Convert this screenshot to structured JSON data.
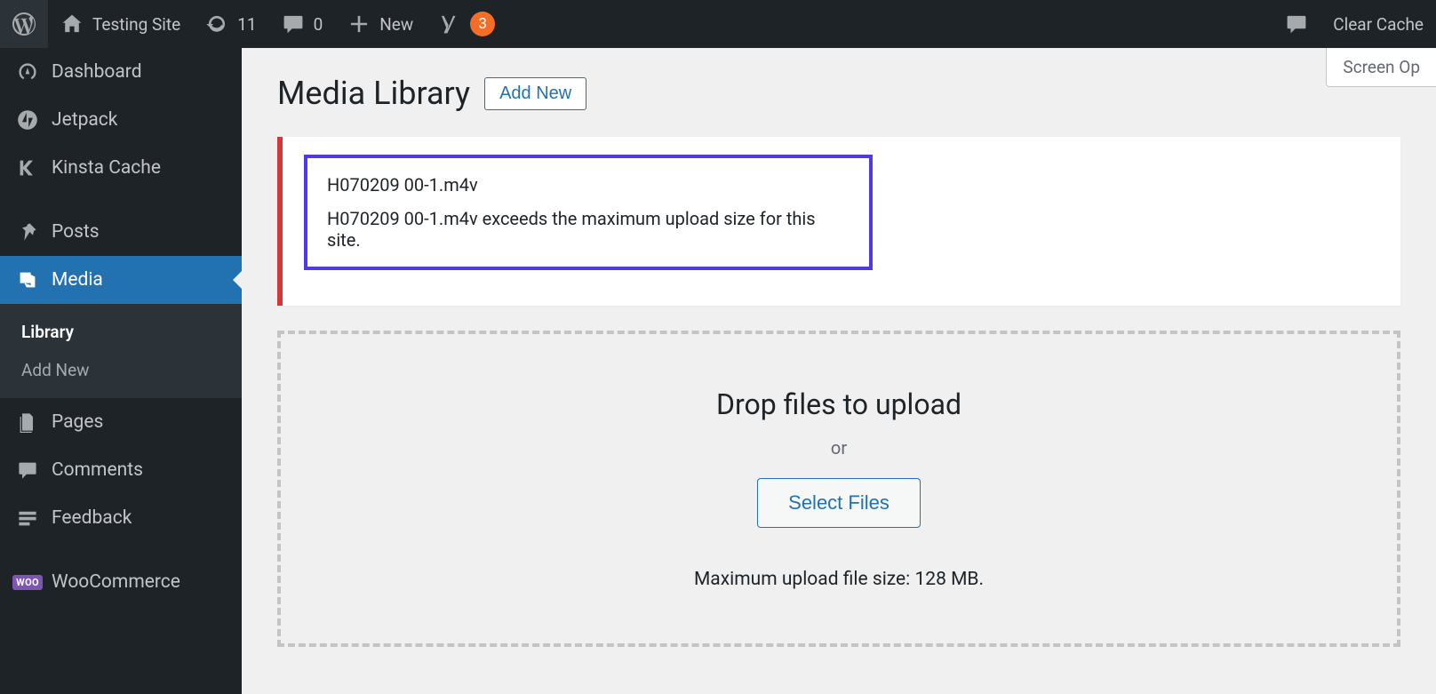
{
  "adminbar": {
    "site_name": "Testing Site",
    "updates_count": "11",
    "comments_count": "0",
    "new_label": "New",
    "yoast_count": "3",
    "clear_cache": "Clear Cache"
  },
  "screen_options": "Screen Op",
  "sidebar": {
    "items": [
      {
        "label": "Dashboard"
      },
      {
        "label": "Jetpack"
      },
      {
        "label": "Kinsta Cache"
      },
      {
        "label": "Posts"
      },
      {
        "label": "Media"
      },
      {
        "label": "Pages"
      },
      {
        "label": "Comments"
      },
      {
        "label": "Feedback"
      },
      {
        "label": "WooCommerce"
      }
    ],
    "media_submenu": {
      "library": "Library",
      "add_new": "Add New"
    }
  },
  "page": {
    "title": "Media Library",
    "add_new": "Add New"
  },
  "error": {
    "filename": "H070209 00-1.m4v",
    "message": "H070209 00-1.m4v exceeds the maximum upload size for this site."
  },
  "dropzone": {
    "title": "Drop files to upload",
    "or": "or",
    "select_files": "Select Files",
    "hint": "Maximum upload file size: 128 MB."
  }
}
